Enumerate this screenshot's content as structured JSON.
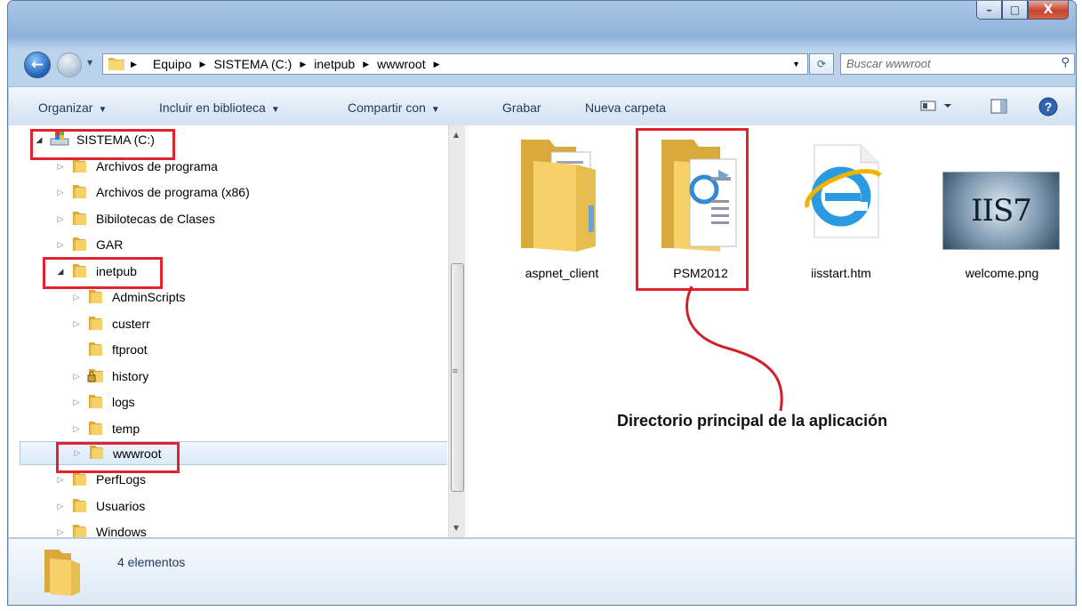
{
  "window": {
    "controls": {
      "minimize": "–",
      "maximize": "□",
      "close": "X"
    }
  },
  "nav": {
    "back_icon": "back-arrow-icon",
    "forward_icon": "forward-arrow-icon",
    "breadcrumb": [
      "Equipo",
      "SISTEMA (C:)",
      "inetpub",
      "wwwroot"
    ],
    "search_placeholder": "Buscar wwwroot"
  },
  "toolbar": {
    "organize": "Organizar",
    "include_library": "Incluir en biblioteca",
    "share_with": "Compartir con",
    "burn": "Grabar",
    "new_folder": "Nueva carpeta"
  },
  "tree": {
    "items": [
      {
        "label": "SISTEMA (C:)",
        "icon": "drive-icon",
        "expanded": true
      },
      {
        "label": "Archivos de programa"
      },
      {
        "label": "Archivos de programa (x86)"
      },
      {
        "label": "Bibilotecas de Clases"
      },
      {
        "label": "GAR"
      },
      {
        "label": "inetpub",
        "expanded": true
      },
      {
        "label": "AdminScripts"
      },
      {
        "label": "custerr"
      },
      {
        "label": "ftproot"
      },
      {
        "label": "history",
        "icon": "locked-folder-icon"
      },
      {
        "label": "logs"
      },
      {
        "label": "temp"
      },
      {
        "label": "wwwroot",
        "selected": true
      },
      {
        "label": "PerfLogs"
      },
      {
        "label": "Usuarios"
      },
      {
        "label": "Windows"
      }
    ]
  },
  "files": [
    {
      "name": "aspnet_client",
      "icon": "folder-icon"
    },
    {
      "name": "PSM2012",
      "icon": "folder-with-documents-icon"
    },
    {
      "name": "iisstart.htm",
      "icon": "internet-explorer-document-icon"
    },
    {
      "name": "welcome.png",
      "icon": "image-thumbnail-icon",
      "thumb_text": "IIS7"
    }
  ],
  "annotation": "Directorio principal de la aplicación",
  "status": {
    "count": "4 elementos"
  },
  "colors": {
    "highlight_red": "#e3222b",
    "folder_yellow": "#f5d46b",
    "selection_blue": "#dbeaf9"
  }
}
